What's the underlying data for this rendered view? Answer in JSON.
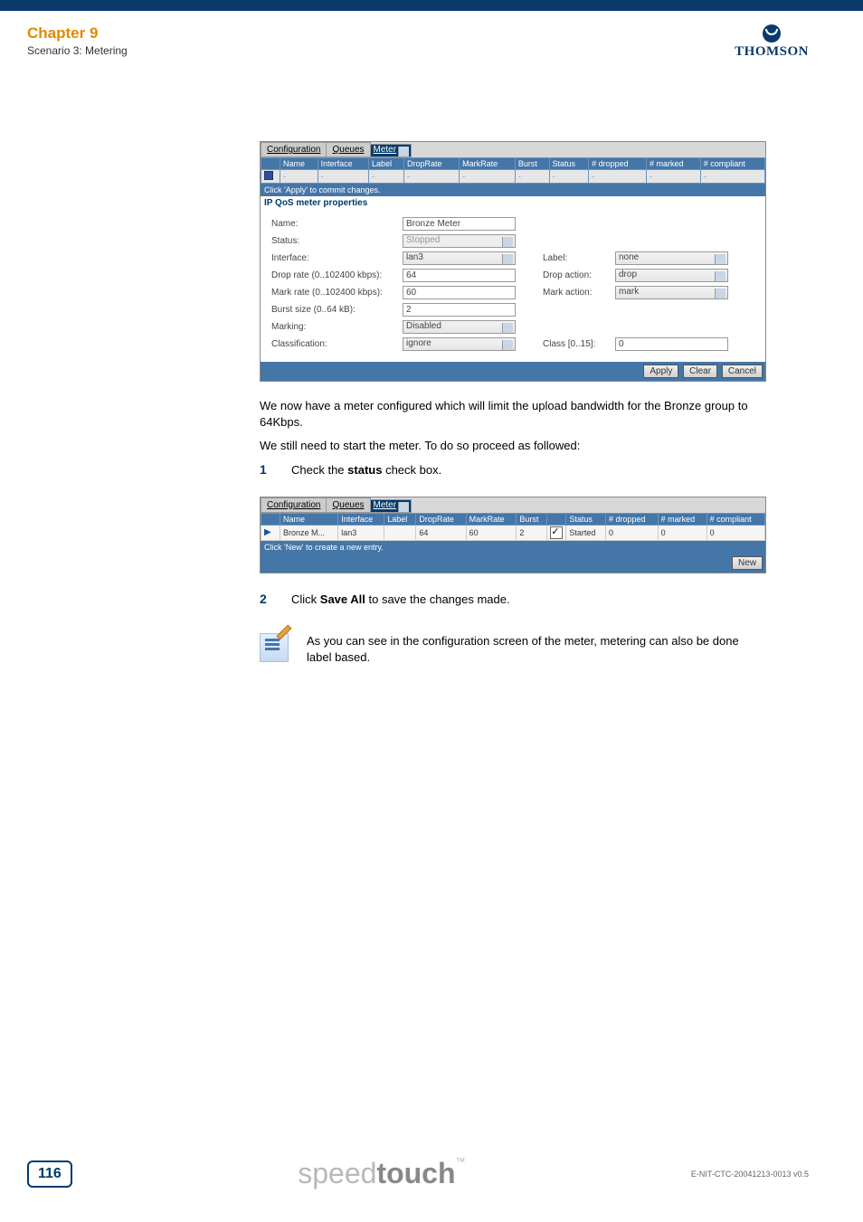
{
  "header": {
    "chapter": "Chapter 9",
    "scenario": "Scenario 3: Metering",
    "logo_text": "THOMSON"
  },
  "shot1": {
    "tabs": {
      "configuration": "Configuration",
      "queues": "Queues",
      "meter": "Meter"
    },
    "columns": {
      "name": "Name",
      "interface": "Interface",
      "label": "Label",
      "droprate": "DropRate",
      "markrate": "MarkRate",
      "burst": "Burst",
      "status": "Status",
      "dropped": "# dropped",
      "marked": "# marked",
      "compliant": "# compliant"
    },
    "row": {
      "name": "-",
      "interface": "-",
      "label": "-",
      "droprate": "-",
      "markrate": "-",
      "burst": "-",
      "status": "-",
      "dropped": "-",
      "marked": "-",
      "compliant": "-"
    },
    "commit_hint": "Click 'Apply' to commit changes.",
    "section": "IP QoS meter properties",
    "fields": {
      "name_label": "Name:",
      "name_value": "Bronze Meter",
      "status_label": "Status:",
      "status_value": "Stopped",
      "interface_label": "Interface:",
      "interface_value": "lan3",
      "label_label": "Label:",
      "label_value": "none",
      "droprate_label": "Drop rate (0..102400 kbps):",
      "droprate_value": "64",
      "dropaction_label": "Drop action:",
      "dropaction_value": "drop",
      "markrate_label": "Mark rate (0..102400 kbps):",
      "markrate_value": "60",
      "markaction_label": "Mark action:",
      "markaction_value": "mark",
      "burst_label": "Burst size (0..64 kB):",
      "burst_value": "2",
      "marking_label": "Marking:",
      "marking_value": "Disabled",
      "classification_label": "Classification:",
      "classification_value": "ignore",
      "class_label": "Class [0..15]:",
      "class_value": "0"
    },
    "buttons": {
      "apply": "Apply",
      "clear": "Clear",
      "cancel": "Cancel"
    }
  },
  "body": {
    "p1": "We now have a meter configured which will limit the upload bandwidth for the Bronze group to 64Kbps.",
    "p2": "We still need to start the meter. To do so proceed as followed:",
    "step1_num": "1",
    "step1a": "Check the ",
    "step1b": "status",
    "step1c": " check box.",
    "step2_num": "2",
    "step2a": "Click ",
    "step2b": "Save All",
    "step2c": " to save the changes made.",
    "note": "As you can see in the configuration screen of the meter, metering can also be done label based."
  },
  "shot2": {
    "tabs": {
      "configuration": "Configuration",
      "queues": "Queues",
      "meter": "Meter"
    },
    "columns": {
      "name": "Name",
      "interface": "Interface",
      "label": "Label",
      "droprate": "DropRate",
      "markrate": "MarkRate",
      "burst": "Burst",
      "status": "Status",
      "dropped": "# dropped",
      "marked": "# marked",
      "compliant": "# compliant"
    },
    "row": {
      "name": "Bronze M...",
      "interface": "lan3",
      "label": "",
      "droprate": "64",
      "markrate": "60",
      "burst": "2",
      "status": "Started",
      "dropped": "0",
      "marked": "0",
      "compliant": "0"
    },
    "new_hint": "Click 'New' to create a new entry.",
    "buttons": {
      "new": "New"
    }
  },
  "footer": {
    "page": "116",
    "brand_a": "speed",
    "brand_b": "touch",
    "tm": "™",
    "docid": "E-NIT-CTC-20041213-0013 v0.5"
  },
  "chart_data": null
}
